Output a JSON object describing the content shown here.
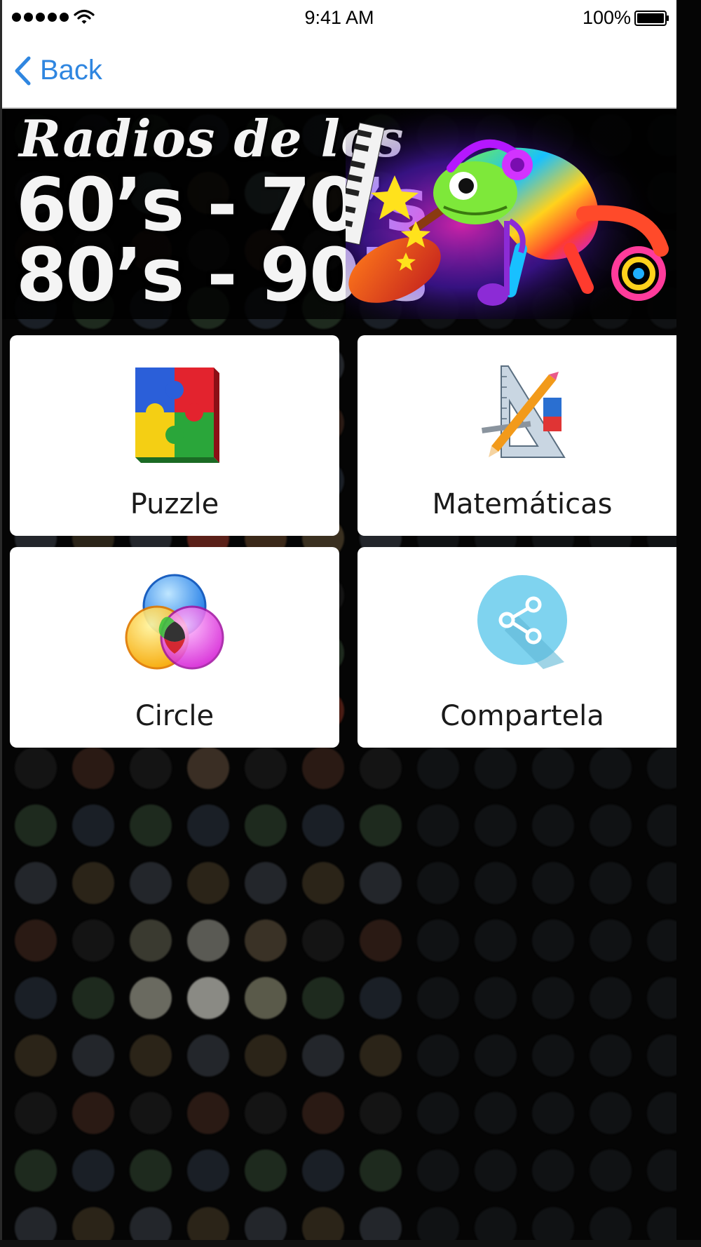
{
  "status_bar": {
    "time": "9:41 AM",
    "battery_percent": "100%"
  },
  "nav": {
    "back_label": "Back"
  },
  "banner": {
    "line1": "Radios de los",
    "line2": "60’s - 70’s",
    "line3": "80’s - 90’s"
  },
  "tiles": [
    {
      "label": "Puzzle",
      "icon": "puzzle-icon"
    },
    {
      "label": "Matemáticas",
      "icon": "math-tools-icon"
    },
    {
      "label": "Circle",
      "icon": "color-circles-icon"
    },
    {
      "label": "Compartela",
      "icon": "share-icon"
    }
  ],
  "colors": {
    "accent": "#2f86e0",
    "share_bg": "#7fd3ef"
  }
}
